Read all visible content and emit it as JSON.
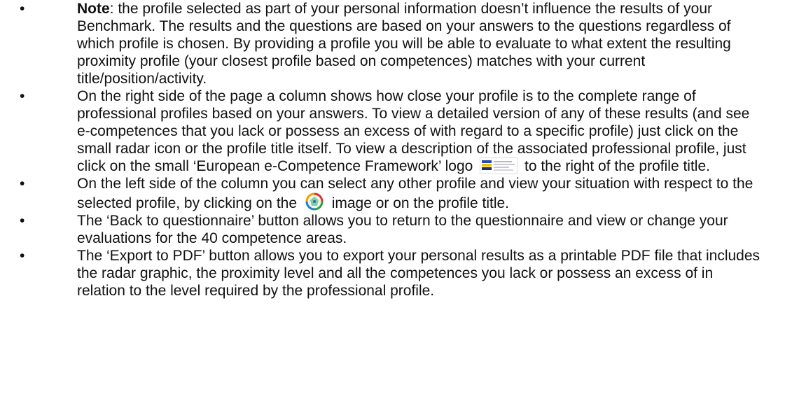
{
  "bullets": {
    "note": {
      "label": "Note",
      "text": ": the profile selected as part of your personal information doesn’t influence the results of your Benchmark. The results and the questions are based on your answers to the questions regardless of which profile is chosen. By providing a profile you will be able to evaluate to what extent the resulting proximity profile (your closest profile based on competences) matches with your current title/position/activity."
    },
    "right_side": {
      "text_before_logo": "On the right side of the page a column shows how close your profile is to the complete range of professional profiles based on your answers. To view a detailed version of any of these results (and see e-competences that you lack or possess an excess of with regard to a specific profile) just click on the small radar icon or the profile title itself. To view a description of the associated professional profile, just click on the small ‘European e-Competence Framework’ logo",
      "text_after_logo": "to the right of the profile title."
    },
    "left_side": {
      "text_before_icon": "On the left side of the column you can select any other profile and view your situation with respect to the selected profile, by clicking on the",
      "text_after_icon": "image or on the profile title."
    },
    "back": {
      "text": "The ‘Back to questionnaire’ button allows you to return to the questionnaire and view or change your evaluations for the 40 competence areas."
    },
    "export": {
      "text": "The ‘Export to PDF’ button allows you to export your personal results as a printable PDF file that includes the radar graphic, the proximity level and all the competences you lack or possess an excess of in relation to the level required by the professional profile."
    },
    "bullet_glyph": "•"
  },
  "icons": {
    "ecf_logo": "ecf-logo-icon",
    "radar": "radar-icon"
  }
}
